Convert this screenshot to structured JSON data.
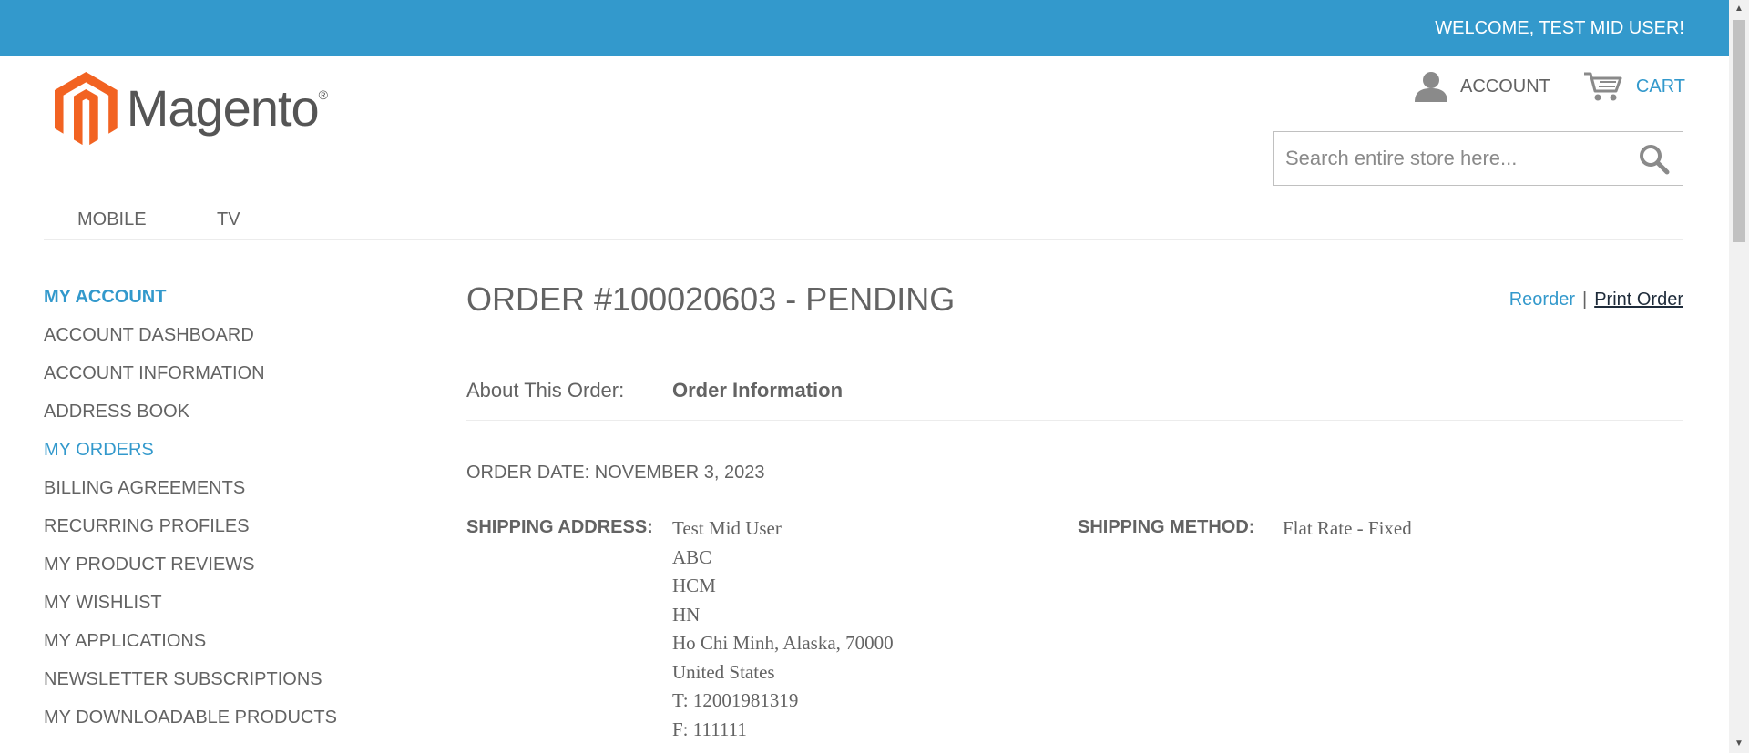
{
  "topbar": {
    "welcome": "WELCOME, TEST MID USER!",
    "background": "#3399cc"
  },
  "header": {
    "logo_text": "Magento",
    "logo_mark": "®",
    "account_label": "ACCOUNT",
    "cart_label": "CART",
    "account_icon": "user-icon",
    "cart_icon": "cart-icon"
  },
  "search": {
    "placeholder": "Search entire store here...",
    "value": "",
    "icon": "search-icon"
  },
  "nav": {
    "items": [
      "MOBILE",
      "TV"
    ]
  },
  "sidebar": {
    "title": "MY ACCOUNT",
    "items": [
      {
        "label": "ACCOUNT DASHBOARD",
        "active": false
      },
      {
        "label": "ACCOUNT INFORMATION",
        "active": false
      },
      {
        "label": "ADDRESS BOOK",
        "active": false
      },
      {
        "label": "MY ORDERS",
        "active": true
      },
      {
        "label": "BILLING AGREEMENTS",
        "active": false
      },
      {
        "label": "RECURRING PROFILES",
        "active": false
      },
      {
        "label": "MY PRODUCT REVIEWS",
        "active": false
      },
      {
        "label": "MY WISHLIST",
        "active": false
      },
      {
        "label": "MY APPLICATIONS",
        "active": false
      },
      {
        "label": "NEWSLETTER SUBSCRIPTIONS",
        "active": false
      },
      {
        "label": "MY DOWNLOADABLE PRODUCTS",
        "active": false
      }
    ]
  },
  "order": {
    "title": "ORDER #100020603 - PENDING",
    "reorder_label": "Reorder",
    "separator": "|",
    "print_label": "Print Order",
    "about_label": "About This Order:",
    "about_tab": "Order Information",
    "order_date": "ORDER DATE: NOVEMBER 3, 2023",
    "shipping_address_label": "SHIPPING ADDRESS:",
    "shipping_address_lines": [
      "Test Mid User",
      "ABC",
      "HCM",
      "HN",
      "Ho Chi Minh, Alaska, 70000",
      "United States",
      "T: 12001981319",
      "F: 111111"
    ],
    "shipping_method_label": "SHIPPING METHOD:",
    "shipping_method_value": "Flat Rate - Fixed"
  },
  "colors": {
    "accent": "#3399cc",
    "text": "#636363",
    "logo_orange": "#f26322"
  }
}
